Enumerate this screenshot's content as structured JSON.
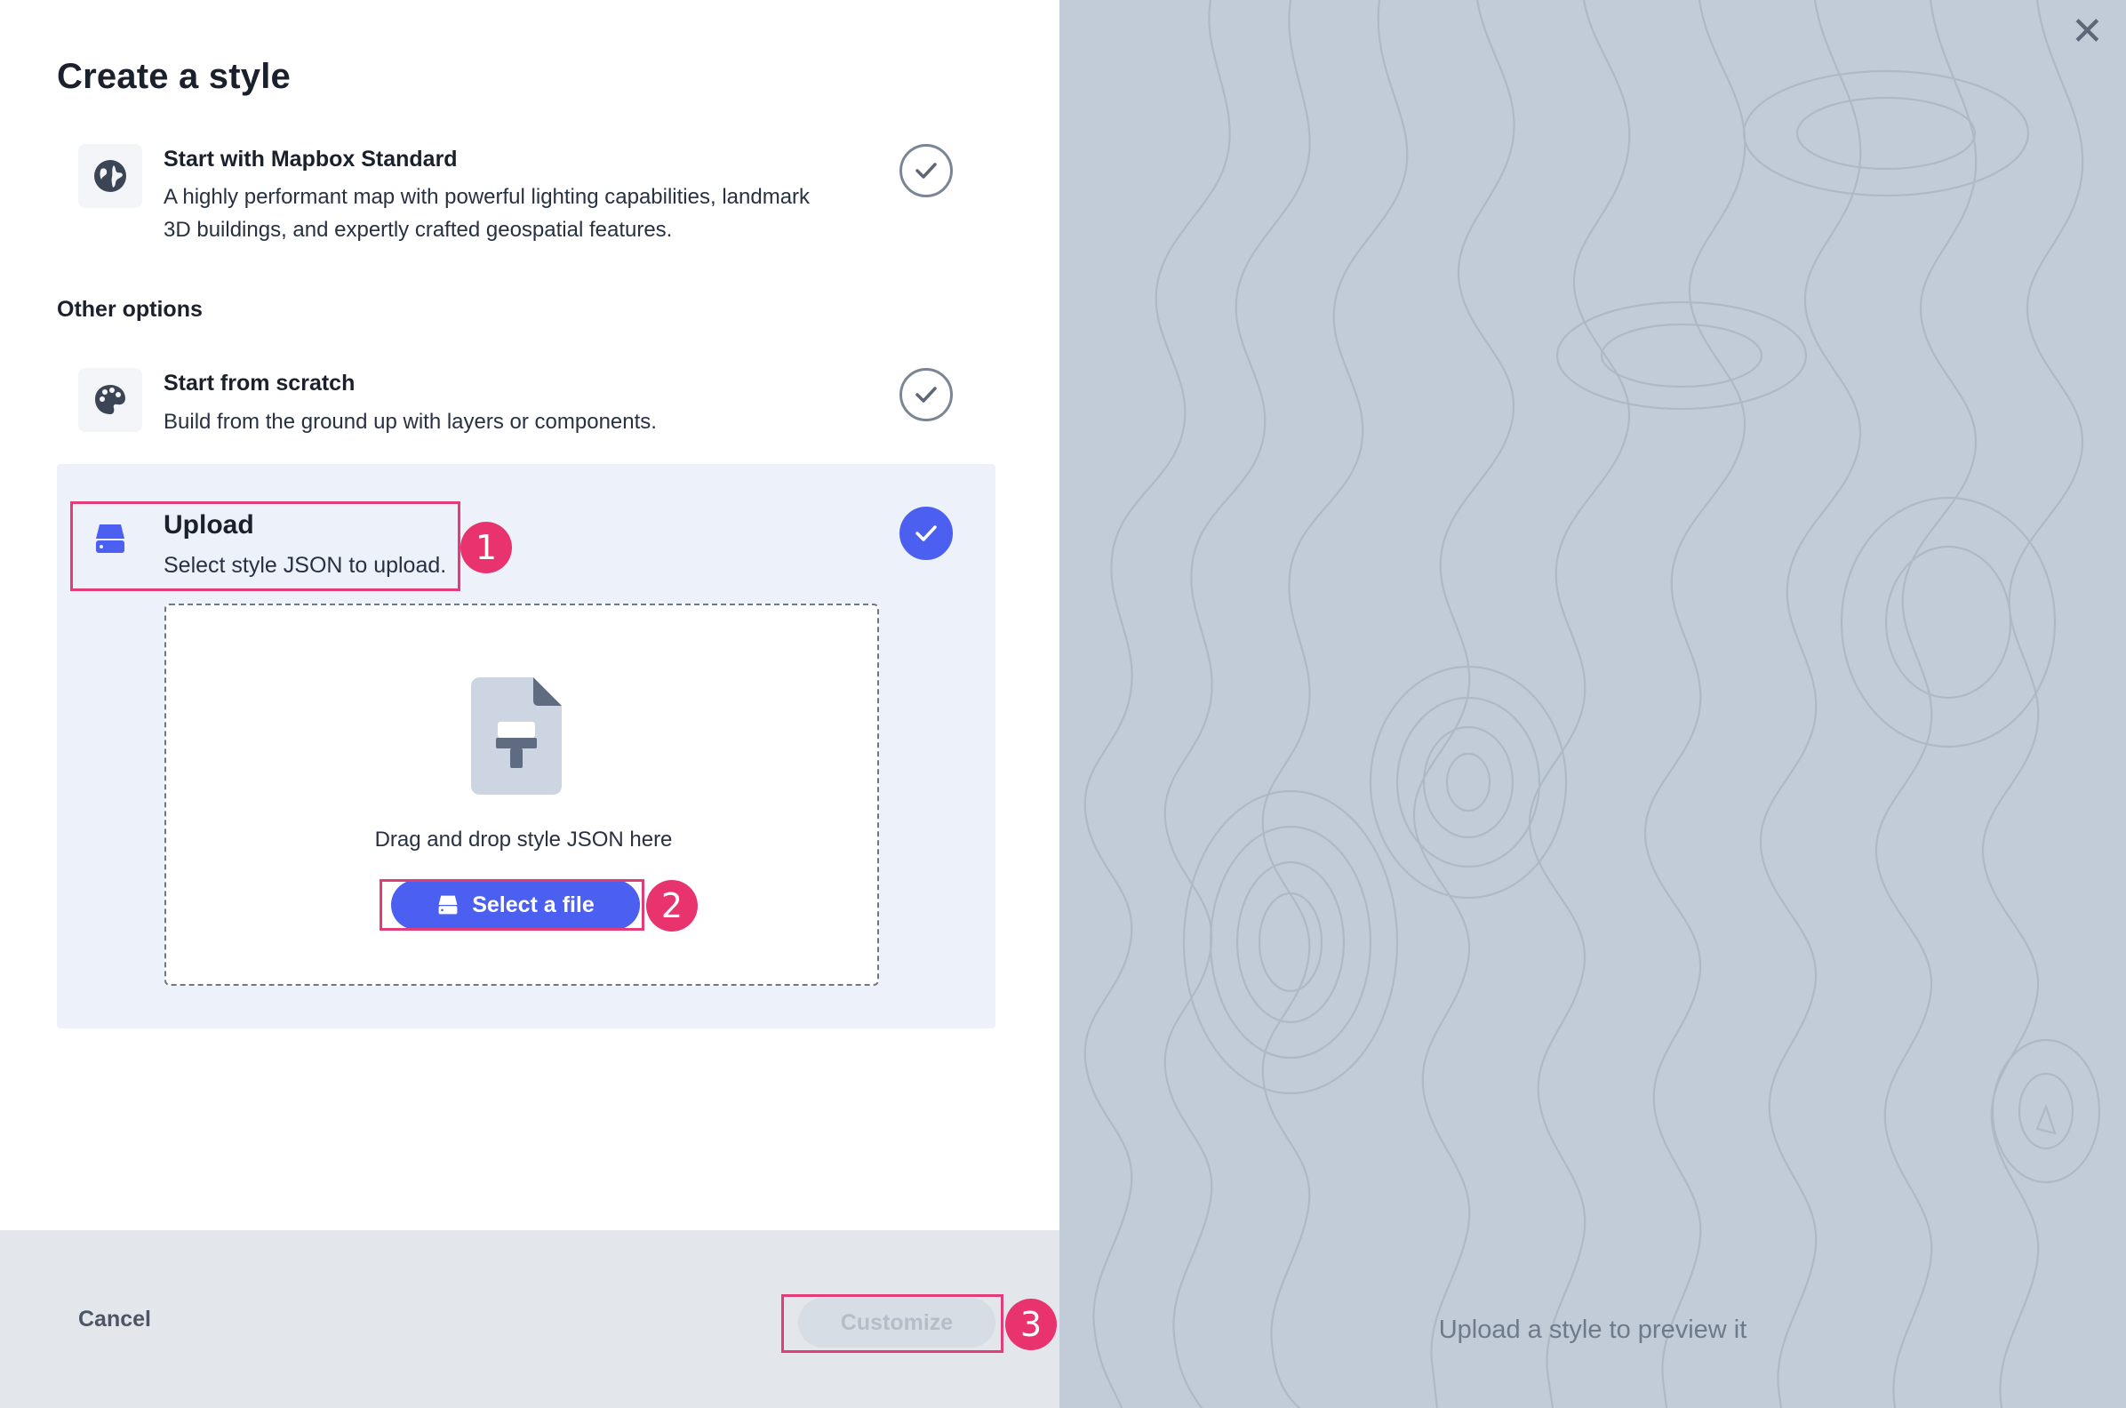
{
  "dialog": {
    "title": "Create a style",
    "close_icon": "close-icon"
  },
  "options": {
    "standard": {
      "title": "Start with Mapbox Standard",
      "description_line1": "A highly performant map with powerful lighting capabilities, landmark",
      "description_line2": "3D buildings, and expertly crafted geospatial features.",
      "icon": "globe-icon",
      "selected": false
    },
    "other_label": "Other options",
    "scratch": {
      "title": "Start from scratch",
      "description": "Build from the ground up with layers or components.",
      "icon": "palette-icon",
      "selected": false
    },
    "upload": {
      "title": "Upload",
      "description": "Select style JSON to upload.",
      "icon": "drive-icon",
      "selected": true
    }
  },
  "dropzone": {
    "icon": "style-file-icon",
    "text": "Drag and drop style JSON here",
    "button_label": "Select a file"
  },
  "footer": {
    "cancel_label": "Cancel",
    "customize_label": "Customize",
    "customize_disabled": true
  },
  "preview": {
    "text": "Upload a style to preview it"
  },
  "annotations": [
    "1",
    "2",
    "3"
  ],
  "colors": {
    "accent": "#4b5ff0",
    "annotation": "#e8336f",
    "preview_bg": "#c1ccd8"
  }
}
